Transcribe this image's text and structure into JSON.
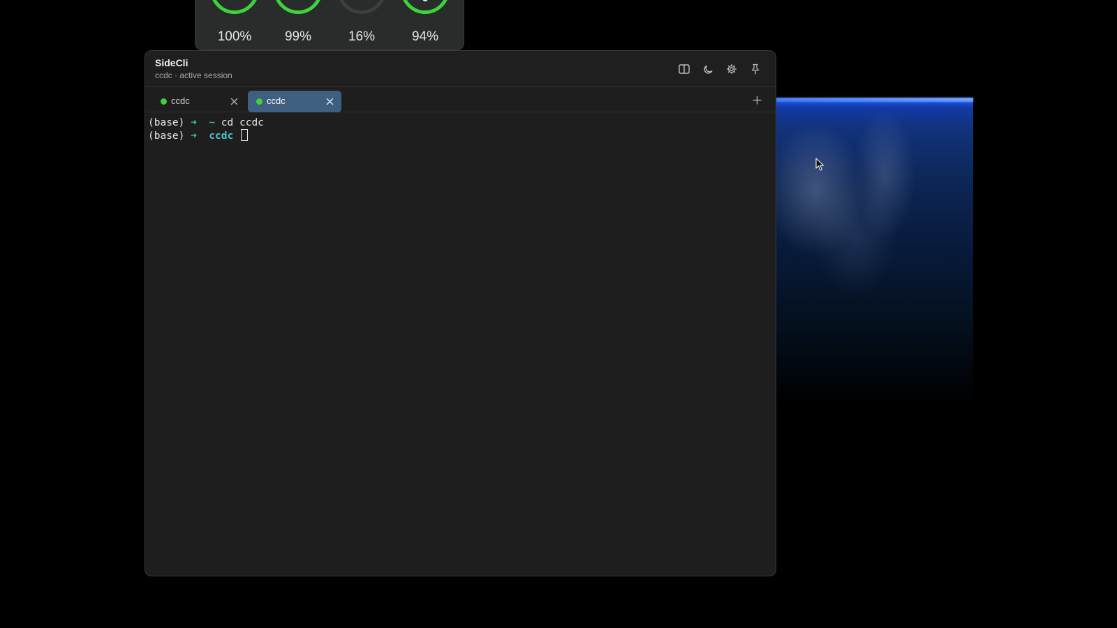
{
  "stats": {
    "gauges": [
      {
        "value": "100%",
        "level": 1.0,
        "color": "#3cd33c"
      },
      {
        "value": "99%",
        "level": 0.99,
        "color": "#3cd33c"
      },
      {
        "value": "16%",
        "level": 0.16,
        "color": "#3d3f3e"
      },
      {
        "value": "94%",
        "level": 0.94,
        "color": "#3cd33c"
      }
    ]
  },
  "window": {
    "title": "SideCli",
    "subtitle": "ccdc · active session",
    "toolbar_icons": [
      "split-view-icon",
      "moon-icon",
      "gear-icon",
      "pin-icon"
    ]
  },
  "tabs": [
    {
      "label": "ccdc",
      "active": false,
      "status_color": "#3cd33c"
    },
    {
      "label": "ccdc",
      "active": true,
      "status_color": "#3cd33c"
    }
  ],
  "terminal": {
    "lines": [
      {
        "env": "(base)",
        "arrow": "➜",
        "cwd": "~",
        "command": "cd ccdc"
      },
      {
        "env": "(base)",
        "arrow": "➜",
        "cwd": "ccdc",
        "command": ""
      }
    ]
  },
  "colors": {
    "accent_tab": "#3f5f80",
    "status_green": "#3cd33c",
    "prompt_arrow": "#39d27a",
    "prompt_cwd": "#4fc3d8"
  }
}
